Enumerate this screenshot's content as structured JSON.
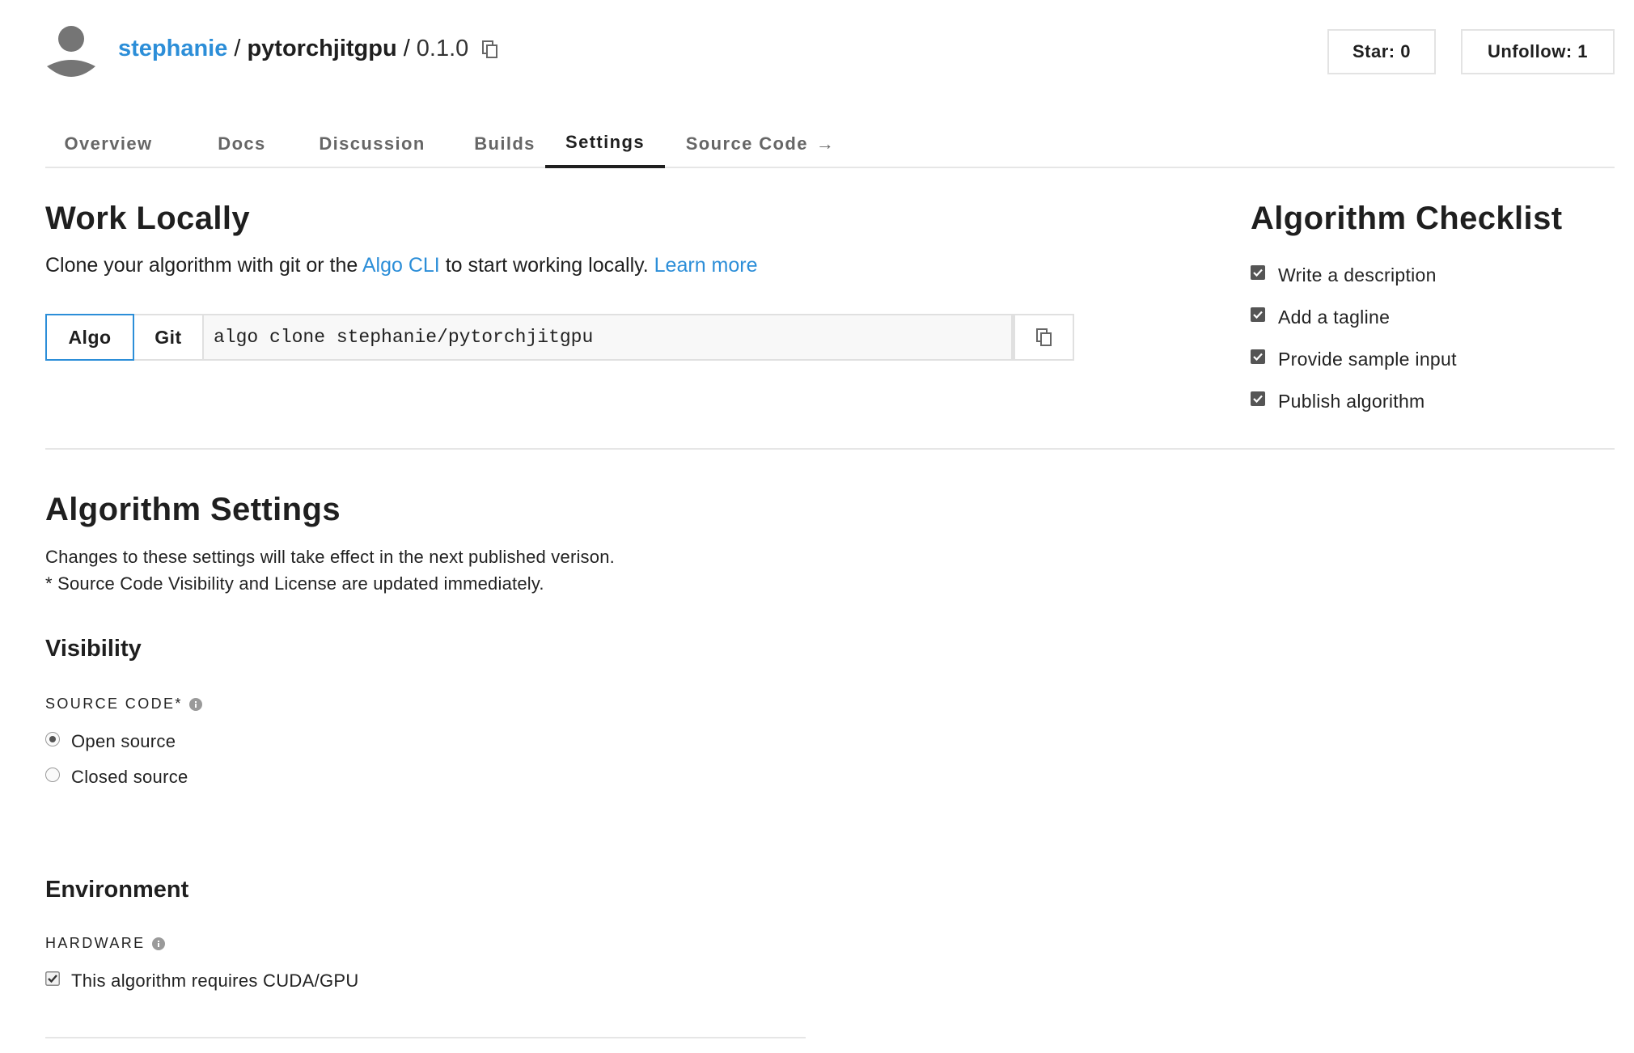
{
  "header": {
    "owner": "stephanie",
    "separator": "/",
    "algorithm": "pytorchjitgpu",
    "version_sep": "/",
    "version": "0.1.0",
    "star_label": "Star: 0",
    "unfollow_label": "Unfollow: 1"
  },
  "tabs": [
    {
      "label": "Overview"
    },
    {
      "label": "Docs"
    },
    {
      "label": "Discussion"
    },
    {
      "label": "Builds"
    },
    {
      "label": "Settings"
    },
    {
      "label": "Source Code"
    }
  ],
  "active_tab": "Settings",
  "work_locally": {
    "title": "Work Locally",
    "desc_prefix": "Clone your algorithm with git or the ",
    "algo_cli_link": "Algo CLI",
    "desc_middle": " to start working locally. ",
    "learn_more_link": "Learn more",
    "algo_button": "Algo",
    "git_button": "Git",
    "clone_command": "algo clone stephanie/pytorchjitgpu",
    "selected_method": "Algo"
  },
  "checklist": {
    "title": "Algorithm Checklist",
    "items": [
      {
        "label": "Write a description",
        "checked": true
      },
      {
        "label": "Add a tagline",
        "checked": true
      },
      {
        "label": "Provide sample input",
        "checked": true
      },
      {
        "label": "Publish algorithm",
        "checked": true
      }
    ]
  },
  "settings": {
    "title": "Algorithm Settings",
    "desc_line1": "Changes to these settings will take effect in the next published verison.",
    "desc_line2": "* Source Code Visibility and License are updated immediately.",
    "visibility": {
      "title": "Visibility",
      "source_code_label": "SOURCE CODE*",
      "options": [
        {
          "label": "Open source",
          "selected": true
        },
        {
          "label": "Closed source",
          "selected": false
        }
      ]
    },
    "environment": {
      "title": "Environment",
      "hardware_label": "HARDWARE",
      "gpu_label": "This algorithm requires CUDA/GPU",
      "gpu_checked": true
    }
  },
  "colors": {
    "link": "#2c8ed8",
    "text": "#1f1f1f",
    "border": "#e6e6e6",
    "checkbox": "#555555"
  }
}
